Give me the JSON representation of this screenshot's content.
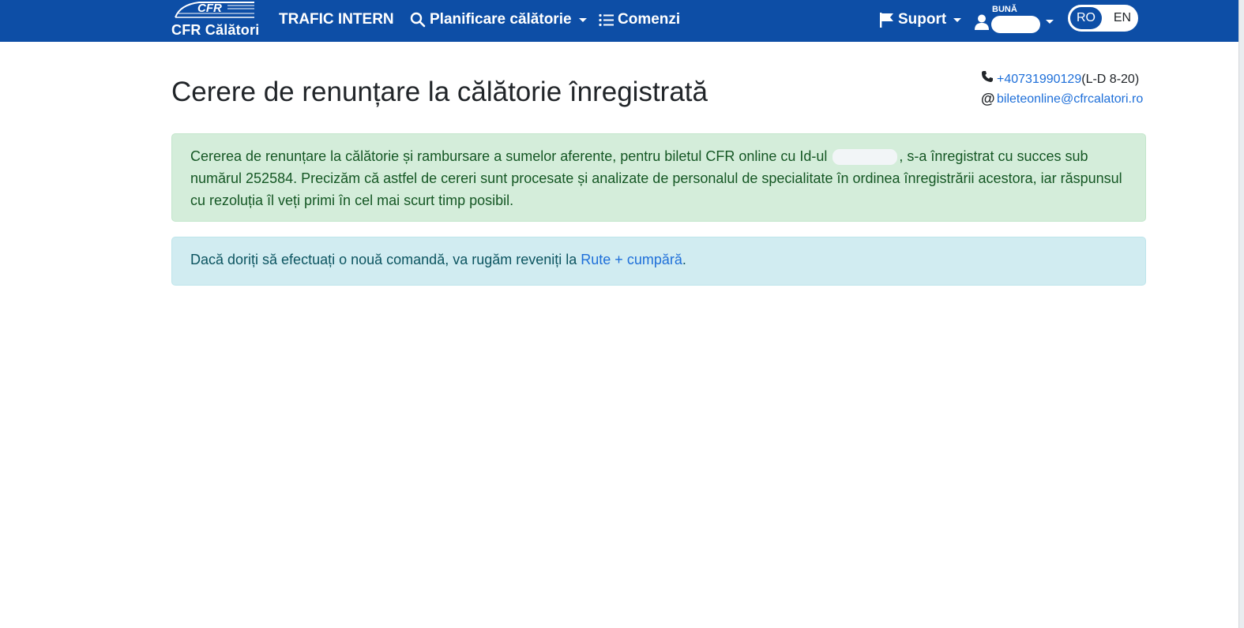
{
  "colors": {
    "brand": "#0d4ea6",
    "link": "#1e6fd9",
    "success_bg": "#d4edda",
    "info_bg": "#d1ecf1"
  },
  "header": {
    "logo_small": "CFR",
    "logo_text": "CFR Călători",
    "nav": {
      "trafic": "TRAFIC INTERN",
      "planificare": "Planificare călătorie",
      "comenzi": "Comenzi"
    },
    "suport": "Suport",
    "greeting": "BUNĂ",
    "lang": {
      "ro": "RO",
      "en": "EN",
      "active": "RO"
    }
  },
  "page": {
    "title": "Cerere de renunțare la călătorie înregistrată"
  },
  "contact": {
    "phone": "+40731990129",
    "hours": " (L-D 8-20)",
    "email": "bileteonline@cfrcalatori.ro"
  },
  "alerts": {
    "success_before_id": "Cererea de renunțare la călătorie și rambursare a sumelor aferente, pentru biletul CFR online cu Id-ul ",
    "success_after_id": ", s-a înregistrat cu succes sub numărul 252584. Precizăm că astfel de cereri sunt procesate și analizate de personalul de specialitate în ordinea înregistrării acestora, iar răspunsul cu rezoluția îl veți primi în cel mai scurt timp posibil.",
    "info_text": "Dacă doriți să efectuați o nouă comandă, va rugăm reveniți la ",
    "info_link": "Rute + cumpără",
    "info_end": "."
  },
  "icons": [
    "train-logo-icon",
    "search-icon",
    "list-icon",
    "flag-icon",
    "user-icon",
    "phone-icon",
    "at-icon"
  ]
}
